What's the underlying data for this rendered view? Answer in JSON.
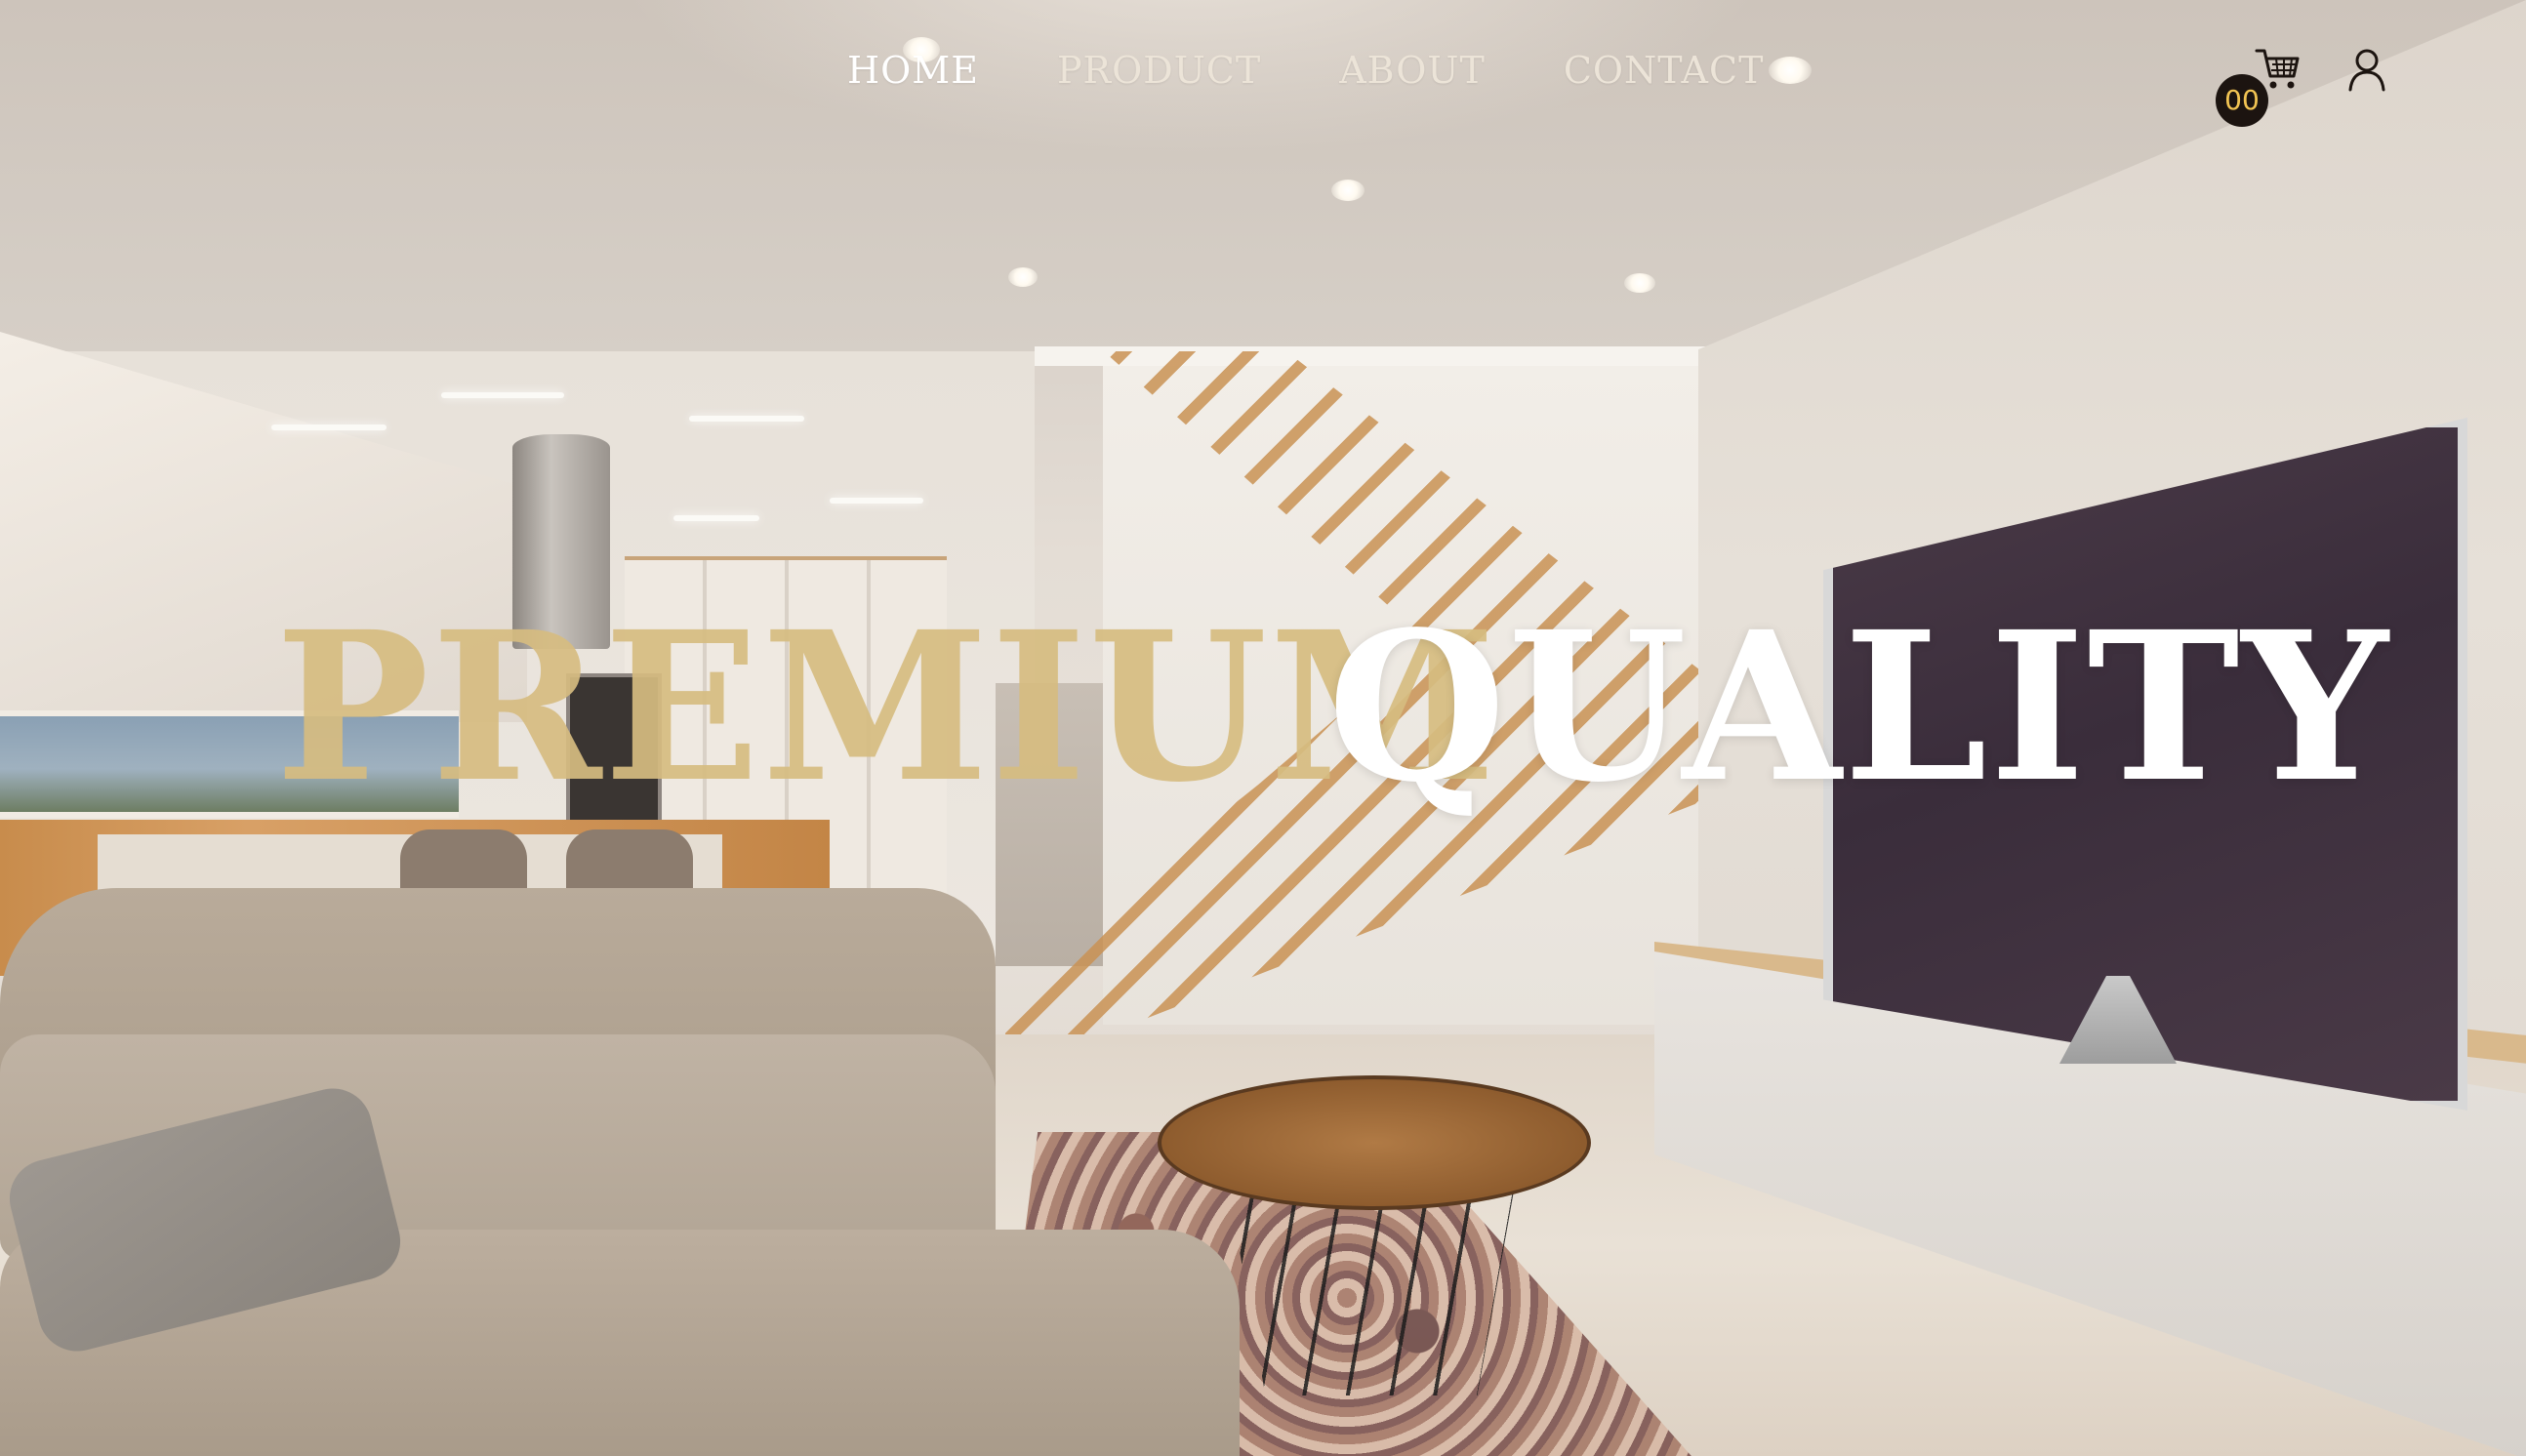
{
  "nav": {
    "links": [
      {
        "label": "HOME",
        "active": true
      },
      {
        "label": "PRODUCT",
        "active": false
      },
      {
        "label": "ABOUT",
        "active": false
      },
      {
        "label": "CONTACT",
        "active": false
      }
    ],
    "cart": {
      "icon": "shopping-cart-icon",
      "count": "00"
    },
    "user": {
      "icon": "user-icon"
    }
  },
  "hero": {
    "word1": "PREMIUM",
    "word2": "QUALITY"
  },
  "colors": {
    "accent_gold": "#d6bc80",
    "nav_text": "#ece4d8",
    "badge_bg": "#1c1410",
    "badge_text": "#f2c453",
    "hero_white": "#ffffff"
  }
}
